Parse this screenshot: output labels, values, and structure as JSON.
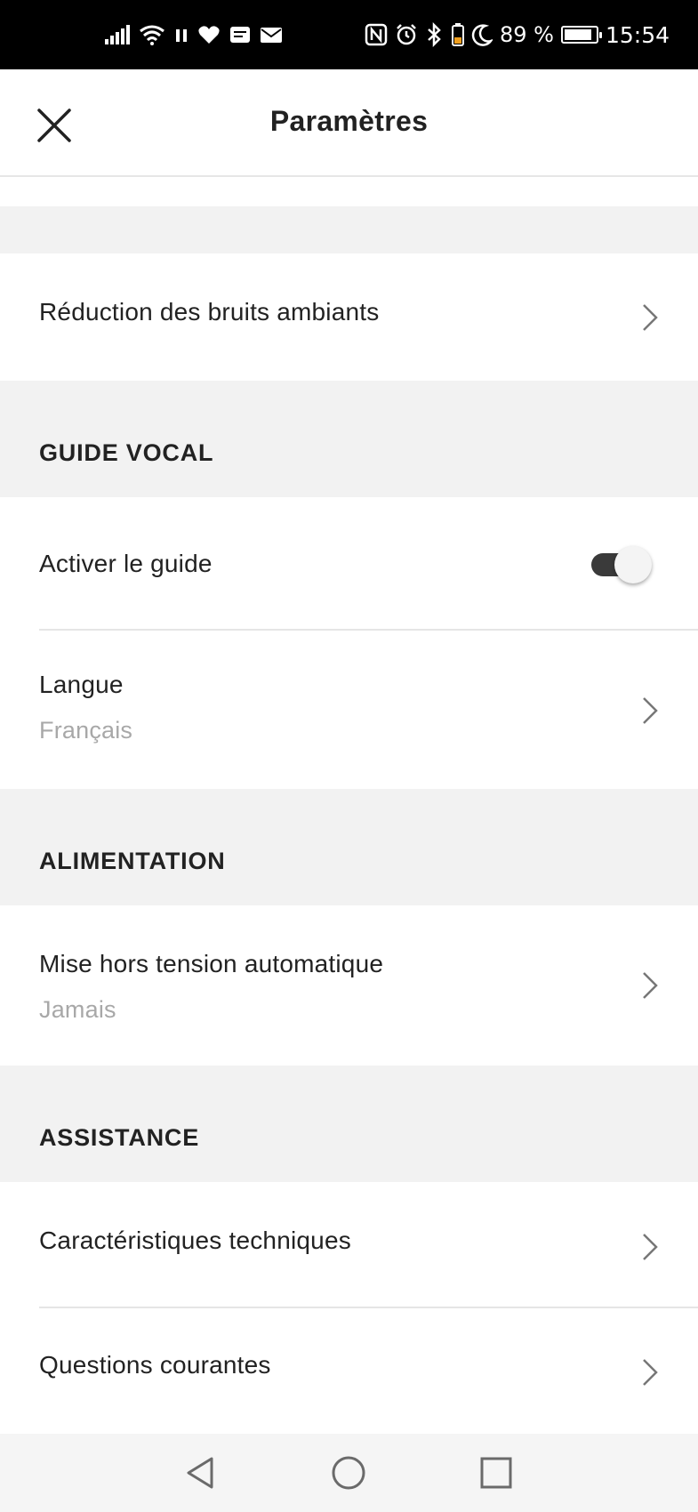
{
  "status_bar": {
    "battery_percent": "89 %",
    "time": "15:54",
    "icons": [
      "signal-icon",
      "wifi-icon",
      "pause-icon",
      "heart-icon",
      "news-icon",
      "mail-icon",
      "nfc-icon",
      "alarm-icon",
      "bluetooth-icon",
      "battery-warning-icon",
      "moon-icon",
      "battery-icon"
    ]
  },
  "header": {
    "title": "Paramètres",
    "close_icon": "close-icon"
  },
  "sections": {
    "noise": {
      "row_label": "Réduction des bruits ambiants"
    },
    "voice_guide": {
      "header": "GUIDE VOCAL",
      "enable_label": "Activer le guide",
      "enable_on": true,
      "language_label": "Langue",
      "language_value": "Français"
    },
    "power": {
      "header": "ALIMENTATION",
      "auto_off_label": "Mise hors tension automatique",
      "auto_off_value": "Jamais"
    },
    "support": {
      "header": "ASSISTANCE",
      "specs_label": "Caractéristiques techniques",
      "faq_label": "Questions courantes"
    }
  },
  "nav_bar": {
    "icons": [
      "back-icon",
      "home-icon",
      "recents-icon"
    ]
  },
  "colors": {
    "background": "#f2f2f2",
    "surface": "#ffffff",
    "text": "#222222",
    "secondary_text": "#a8a8a8",
    "toggle_track": "#3a3a3a"
  }
}
